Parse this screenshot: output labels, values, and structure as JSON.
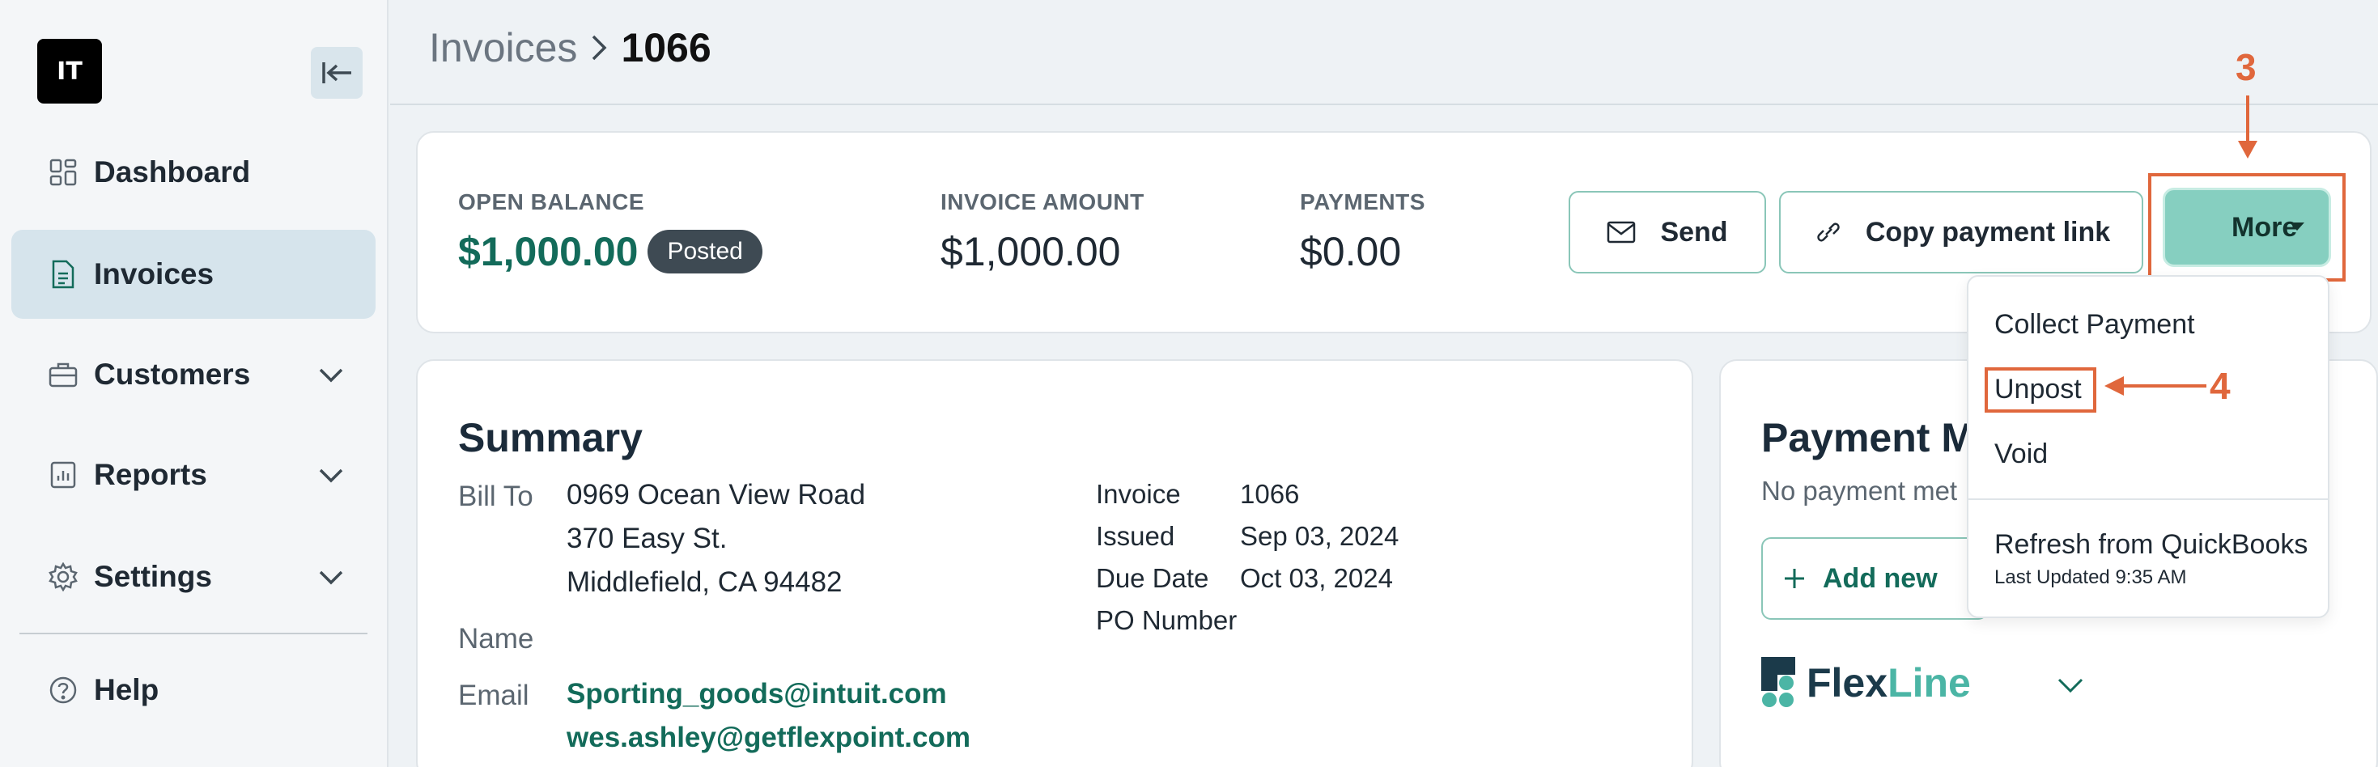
{
  "colors": {
    "accent": "#136b5a",
    "more_button": "#86cfc0",
    "annotation": "#e0673c",
    "badge": "#3e4a53"
  },
  "sidebar": {
    "logo_text": "IT",
    "items": [
      {
        "label": "Dashboard",
        "icon": "dashboard-icon"
      },
      {
        "label": "Invoices",
        "icon": "document-icon",
        "active": true
      },
      {
        "label": "Customers",
        "icon": "briefcase-icon",
        "expandable": true
      },
      {
        "label": "Reports",
        "icon": "report-icon",
        "expandable": true
      },
      {
        "label": "Settings",
        "icon": "gear-icon",
        "expandable": true
      },
      {
        "label": "Help",
        "icon": "help-icon"
      }
    ]
  },
  "header": {
    "breadcrumb_parent": "Invoices",
    "breadcrumb_current": "1066"
  },
  "balance": {
    "open_label": "OPEN BALANCE",
    "open_value": "$1,000.00",
    "status": "Posted",
    "amount_label": "INVOICE AMOUNT",
    "amount_value": "$1,000.00",
    "payments_label": "PAYMENTS",
    "payments_value": "$0.00"
  },
  "actions": {
    "send": "Send",
    "copy_link": "Copy payment link",
    "more": "More"
  },
  "dropdown": {
    "items": [
      "Collect Payment",
      "Unpost",
      "Void",
      "Refresh from QuickBooks"
    ],
    "last_updated": "Last Updated 9:35 AM"
  },
  "summary": {
    "title": "Summary",
    "bill_to_label": "Bill To",
    "address": [
      "0969 Ocean View Road",
      "370 Easy St.",
      "Middlefield, CA 94482"
    ],
    "name_label": "Name",
    "email_label": "Email",
    "emails": [
      "Sporting_goods@intuit.com",
      "wes.ashley@getflexpoint.com"
    ],
    "details": [
      {
        "label": "Invoice",
        "value": "1066"
      },
      {
        "label": "Issued",
        "value": "Sep 03, 2024"
      },
      {
        "label": "Due Date",
        "value": "Oct 03, 2024"
      },
      {
        "label": "PO Number",
        "value": ""
      }
    ]
  },
  "payment": {
    "title": "Payment M",
    "subtitle": "No payment met",
    "add_new": "Add new",
    "brand_dark": "Flex",
    "brand_teal": "Line"
  },
  "annotations": {
    "step3": "3",
    "step4": "4"
  }
}
